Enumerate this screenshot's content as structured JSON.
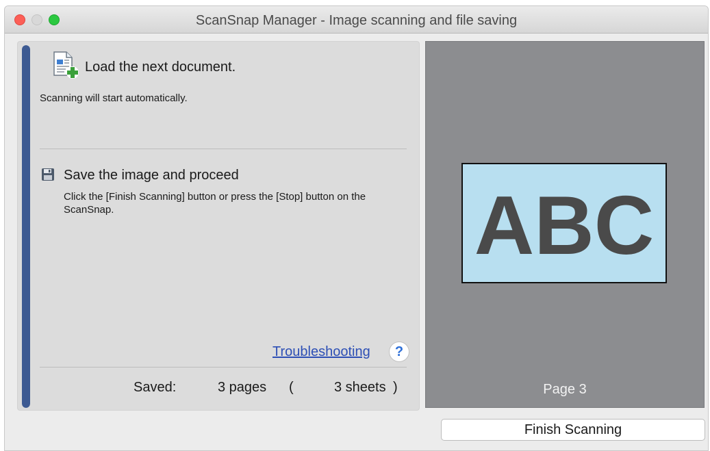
{
  "window": {
    "title": "ScanSnap Manager - Image scanning and file saving"
  },
  "step1": {
    "icon": "document-add-icon",
    "title": "Load the next document.",
    "description": "Scanning will start automatically."
  },
  "step2": {
    "icon": "floppy-disk-icon",
    "title": "Save the image and proceed",
    "description": "Click the [Finish Scanning] button or press the [Stop] button on the ScanSnap."
  },
  "progress": {
    "fraction": 1.0,
    "color": "#3d5a92"
  },
  "troubleshooting": {
    "link_label": "Troubleshooting",
    "help_icon": "question-mark-icon",
    "help_label": "?"
  },
  "summary": {
    "saved_label": "Saved:",
    "pages": "3 pages",
    "paren_open": "(",
    "sheets": "3 sheets",
    "paren_close": ")"
  },
  "preview": {
    "image_text": "ABC",
    "page_label": "Page 3",
    "background_color": "#8c8d90",
    "image_color": "#b8dff0"
  },
  "buttons": {
    "finish_label": "Finish Scanning"
  }
}
